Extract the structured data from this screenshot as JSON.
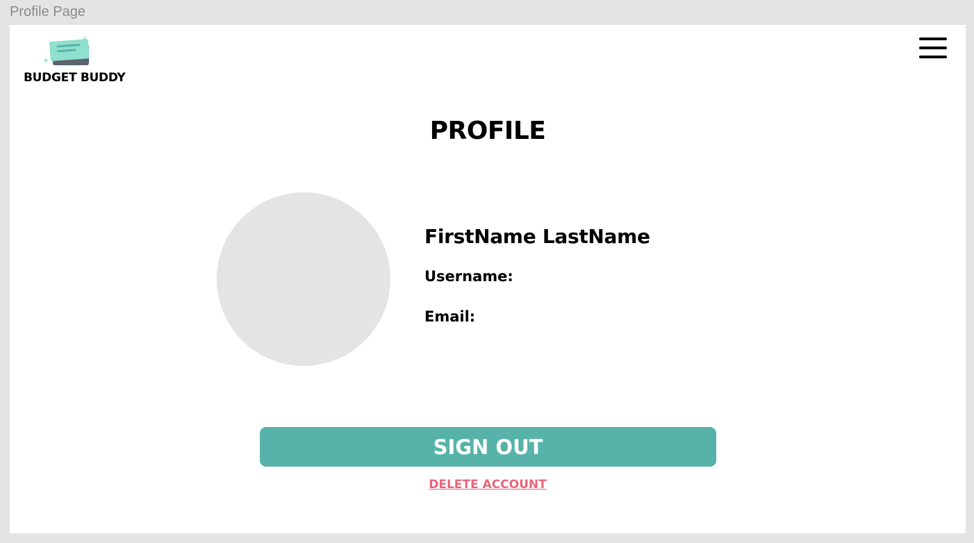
{
  "frame": {
    "label": "Profile Page"
  },
  "header": {
    "logo_text": "BUDGET BUDDY",
    "logo_icon": "stacked-cards-sparkle-icon",
    "menu_icon": "hamburger-menu-icon"
  },
  "profile": {
    "title": "PROFILE",
    "full_name": "FirstName LastName",
    "username_label": "Username:",
    "email_label": "Email:"
  },
  "actions": {
    "sign_out_label": "SIGN OUT",
    "delete_account_label": "DELETE ACCOUNT"
  },
  "colors": {
    "accent": "#57b2a9",
    "danger": "#e8647a",
    "avatar_placeholder": "#e4e4e4",
    "logo_card_front": "#8fe0cf",
    "logo_card_back": "#5c6470"
  }
}
